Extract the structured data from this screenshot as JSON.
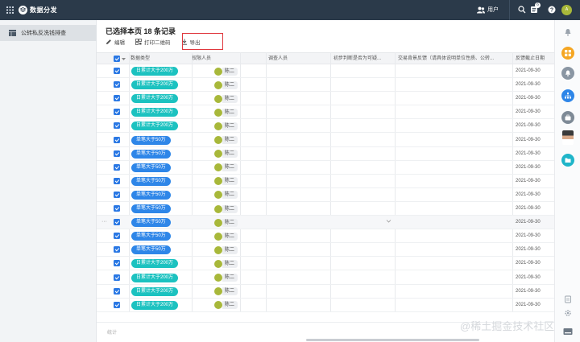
{
  "topbar": {
    "app_title": "数据分发",
    "user_label": "用户",
    "notification_count": "6",
    "avatar_text": "A"
  },
  "sidebar": {
    "items": [
      {
        "label": "公转私反洗钱排查"
      }
    ]
  },
  "main": {
    "selection_title": "已选择本页 18 条记录",
    "toolbar": {
      "edit_label": "编辑",
      "print_qr_label": "打印二维码",
      "export_label": "导出"
    }
  },
  "table": {
    "columns": [
      {
        "label": "数据类型"
      },
      {
        "label": "权限人员"
      },
      {
        "label": "调查人员"
      },
      {
        "label": "初步判断是否为可疑..."
      },
      {
        "label": "交易背景反馈（请具体说明单位性质、公转..."
      },
      {
        "label": "反馈截止日期"
      }
    ],
    "rows": [
      {
        "type": "日累计大于200万",
        "person": "陈二",
        "date": "2021-09-30"
      },
      {
        "type": "日累计大于200万",
        "person": "陈二",
        "date": "2021-09-30"
      },
      {
        "type": "日累计大于200万",
        "person": "陈二",
        "date": "2021-09-30"
      },
      {
        "type": "日累计大于200万",
        "person": "陈二",
        "date": "2021-09-30"
      },
      {
        "type": "日累计大于200万",
        "person": "陈二",
        "date": "2021-09-30"
      },
      {
        "type": "单笔大于50万",
        "person": "陈二",
        "date": "2021-09-30"
      },
      {
        "type": "单笔大于50万",
        "person": "陈二",
        "date": "2021-09-30"
      },
      {
        "type": "单笔大于50万",
        "person": "陈二",
        "date": "2021-09-30"
      },
      {
        "type": "单笔大于50万",
        "person": "陈二",
        "date": "2021-09-30"
      },
      {
        "type": "单笔大于50万",
        "person": "陈二",
        "date": "2021-09-30"
      },
      {
        "type": "单笔大于50万",
        "person": "陈二",
        "date": "2021-09-30"
      },
      {
        "type": "单笔大于50万",
        "person": "陈二",
        "date": "2021-09-30"
      },
      {
        "type": "单笔大于50万",
        "person": "陈二",
        "date": "2021-09-30"
      },
      {
        "type": "单笔大于50万",
        "person": "陈二",
        "date": "2021-09-30"
      },
      {
        "type": "日累计大于200万",
        "person": "陈二",
        "date": "2021-09-30"
      },
      {
        "type": "日累计大于200万",
        "person": "陈二",
        "date": "2021-09-30"
      },
      {
        "type": "日累计大于200万",
        "person": "陈二",
        "date": "2021-09-30"
      },
      {
        "type": "日累计大于200万",
        "person": "陈二",
        "date": "2021-09-30"
      }
    ],
    "footer_stat_label": "统计"
  },
  "colors": {
    "topbar_bg": "#2b3a4a",
    "tag_teal": "#1cc2c0",
    "tag_blue": "#2e86e8",
    "checkbox_blue": "#2a78e4",
    "highlight_red": "#e0383e",
    "avatar_olive": "#a8b83a"
  },
  "watermark": "@稀土掘金技术社区"
}
